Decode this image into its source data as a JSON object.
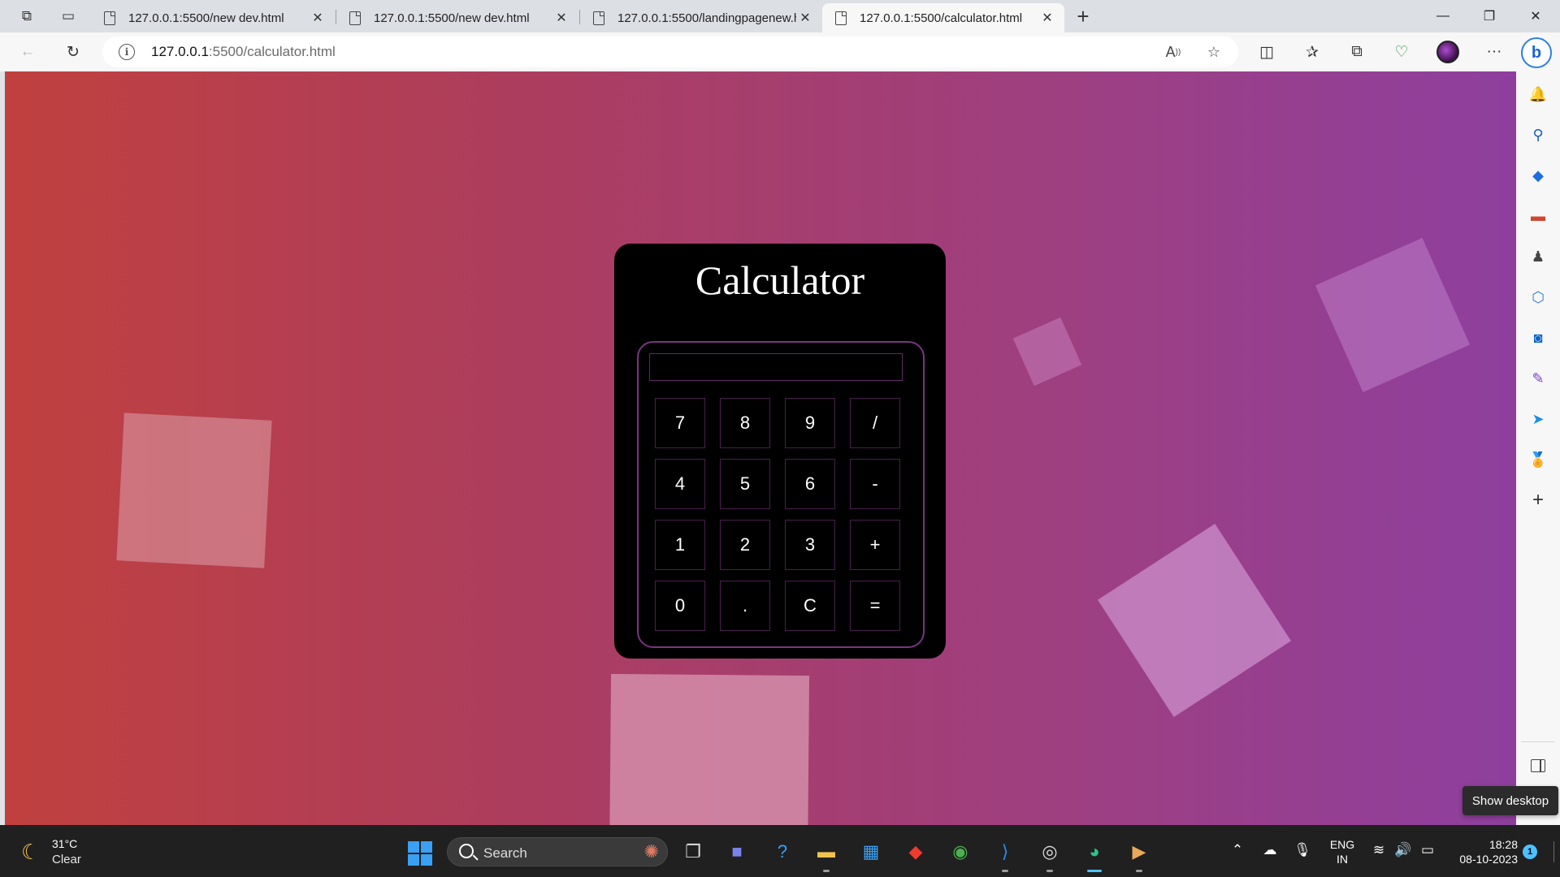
{
  "browser": {
    "tabs": [
      {
        "title": "127.0.0.1:5500/new dev.html",
        "active": false
      },
      {
        "title": "127.0.0.1:5500/new dev.html",
        "active": false
      },
      {
        "title": "127.0.0.1:5500/landingpagenew.h",
        "active": false
      },
      {
        "title": "127.0.0.1:5500/calculator.html",
        "active": true
      }
    ],
    "tab_close_glyph": "✕",
    "new_tab_glyph": "+",
    "window_controls": {
      "minimize": "—",
      "restore": "❐",
      "close": "✕"
    },
    "address": {
      "host": "127.0.0.1",
      "path": ":5500/calculator.html"
    },
    "toolbar_icons": [
      "back-icon",
      "refresh-icon",
      "site-info-icon",
      "read-aloud-icon",
      "favorite-star-icon",
      "split-screen-icon",
      "favorites-icon",
      "collections-icon",
      "browser-essentials-icon",
      "profile-avatar",
      "settings-more-icon",
      "bing-copilot-icon"
    ]
  },
  "page": {
    "background_colors": [
      "#c0403e",
      "#ac3d5f",
      "#9e3f81",
      "#8e3f9e"
    ],
    "calculator": {
      "title": "Calculator",
      "display_value": "",
      "keys": [
        [
          "7",
          "8",
          "9",
          "/"
        ],
        [
          "4",
          "5",
          "6",
          "-"
        ],
        [
          "1",
          "2",
          "3",
          "+"
        ],
        [
          "0",
          ".",
          "C",
          "="
        ]
      ],
      "panel_color": "#000000",
      "border_color": "#7a3580"
    }
  },
  "sidebar": {
    "icons": [
      "bell-icon",
      "search-icon",
      "shopping-tag-icon",
      "tools-briefcase-icon",
      "games-icon",
      "microsoft-365-icon",
      "outlook-icon",
      "drop-icon",
      "telegram-send-icon",
      "rewards-medal-icon",
      "add-icon"
    ],
    "tooltip": "Show desktop"
  },
  "taskbar": {
    "weather": {
      "temp": "31°C",
      "condition": "Clear"
    },
    "search_placeholder": "Search",
    "apps": [
      "task-view-icon",
      "teams-meet-icon",
      "quick-assist-icon",
      "file-explorer-icon",
      "microsoft-store-icon",
      "anydesk-icon",
      "chrome-icon",
      "vscode-icon",
      "obs-icon",
      "edge-icon",
      "media-player-icon"
    ],
    "tray": {
      "language_line1": "ENG",
      "language_line2": "IN",
      "time": "18:28",
      "date": "08-10-2023",
      "notification_count": "1"
    }
  }
}
